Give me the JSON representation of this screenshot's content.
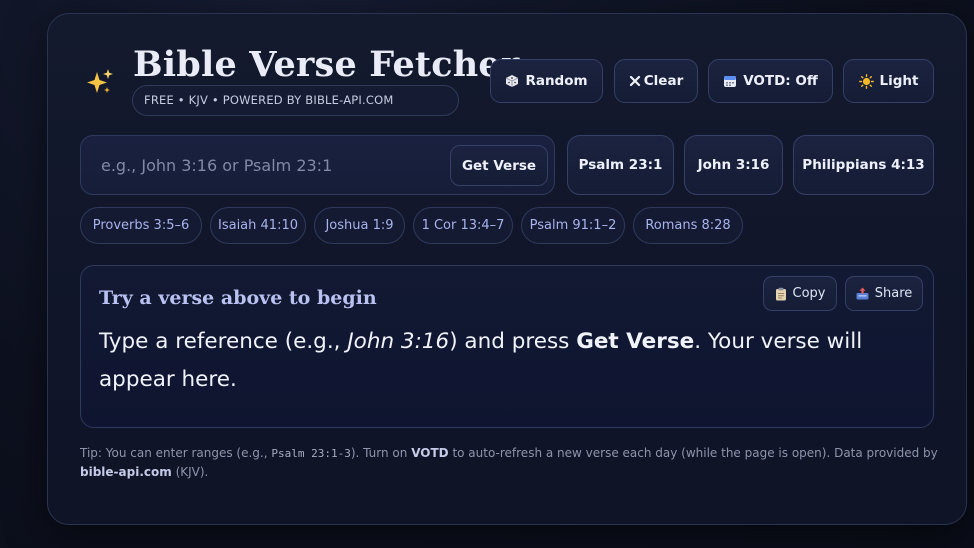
{
  "app": {
    "title": "Bible Verse Fetcher",
    "subtitle": "FREE • KJV • POWERED BY BIBLE-API.COM",
    "logo_icon": "sparkles-icon"
  },
  "toolbar": {
    "random_label": "Random",
    "clear_label": "Clear",
    "votd_label": "VOTD: Off",
    "theme_label": "Light"
  },
  "search": {
    "placeholder": "e.g., John 3:16 or Psalm 23:1",
    "value": "",
    "submit_label": "Get Verse"
  },
  "quick_refs": [
    "Psalm 23:1",
    "John 3:16",
    "Philippians 4:13"
  ],
  "chips": [
    "Proverbs 3:5–6",
    "Isaiah 41:10",
    "Joshua 1:9",
    "1 Cor 13:4–7",
    "Psalm 91:1–2",
    "Romans 8:28"
  ],
  "verse": {
    "reference": "Try a verse above to begin",
    "text_before": "Type a reference (e.g., ",
    "text_example": "John 3:16",
    "text_middle": ") and press ",
    "text_action": "Get Verse",
    "text_after": ". Your verse will appear here.",
    "copy_label": "Copy",
    "share_label": "Share"
  },
  "tip": {
    "part1": "Tip: You can enter ranges (e.g., ",
    "code": "Psalm 23:1-3",
    "part2": "). Turn on ",
    "votd": "VOTD",
    "part3": " to auto-refresh a new verse each day (while the page is open). Data provided by ",
    "source": "bible-api.com",
    "part4": " (KJV)."
  },
  "colors": {
    "background": "#0c0f1a",
    "card": "#141a2e",
    "accent": "#a9b3ee",
    "text": "#e9ecf6"
  }
}
